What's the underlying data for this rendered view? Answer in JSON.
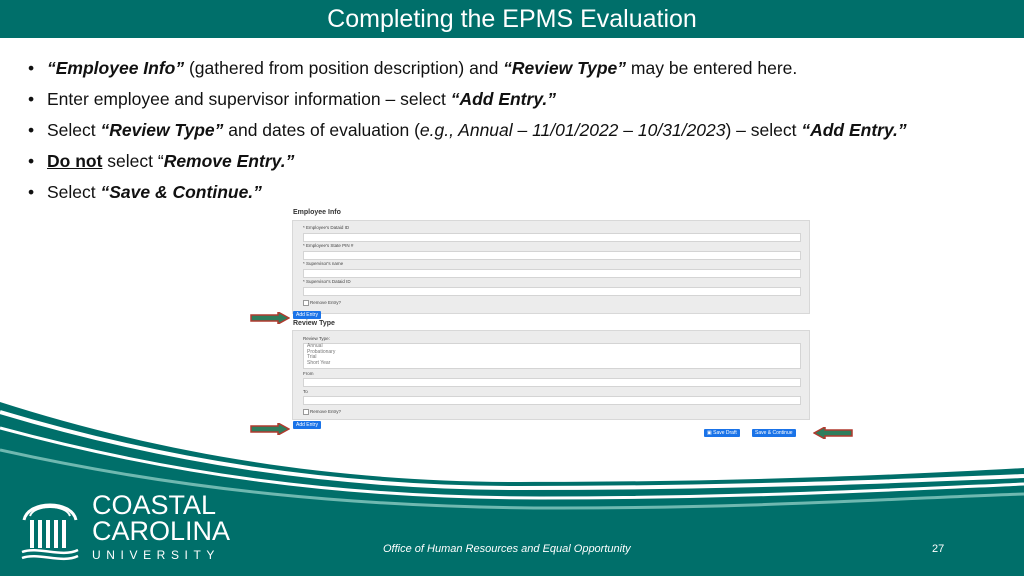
{
  "slide": {
    "title": "Completing the EPMS Evaluation",
    "page_number": "27",
    "footer": "Office of Human Resources and Equal Opportunity"
  },
  "bullets": {
    "b1": {
      "a": "“Employee Info”",
      "b": " (gathered from position description) and ",
      "c": "“Review Type”",
      "d": " may be entered here."
    },
    "b2": {
      "a": "Enter employee and supervisor information – select ",
      "b": "“Add Entry.”"
    },
    "b3": {
      "a": "Select ",
      "b": "“Review Type”",
      "c": " and dates of evaluation (",
      "d": "e.g., Annual – 11/01/2022 – 10/31/2023",
      "e": ") – select ",
      "f": "“Add Entry.”"
    },
    "b4": {
      "a": "Do not",
      "b": " select “",
      "c": "Remove Entry.”"
    },
    "b5": {
      "a": "Select ",
      "b": "“Save & Continue.”"
    }
  },
  "form": {
    "employee_info_title": "Employee Info",
    "employee_dataid_label": "* Employee's Dataid ID",
    "employee_state_pin_label": "* Employee's State PIN #",
    "supervisor_name_label": "* Supervisor's name",
    "supervisor_dataid_label": "* Supervisor's Dataid ID",
    "remove_entry_label": "Remove Entry?",
    "add_entry_label": "Add Entry",
    "review_type_title": "Review Type",
    "review_type_label": "Review Type:",
    "review_options": [
      "Annual",
      "Probationary",
      "Trial",
      "Short Year"
    ],
    "from_label": "From",
    "to_label": "To",
    "remove_entry_label_2": "Remove Entry?",
    "add_entry_label_2": "Add Entry",
    "save_draft_label": "Save Draft",
    "save_continue_label": "Save & Continue"
  },
  "logo": {
    "line1": "COASTAL",
    "line2": "CAROLINA",
    "line3": "UNIVERSITY"
  },
  "colors": {
    "teal": "#006f6a",
    "button_blue": "#1a73e8",
    "arrow_red": "#b03a2e"
  }
}
